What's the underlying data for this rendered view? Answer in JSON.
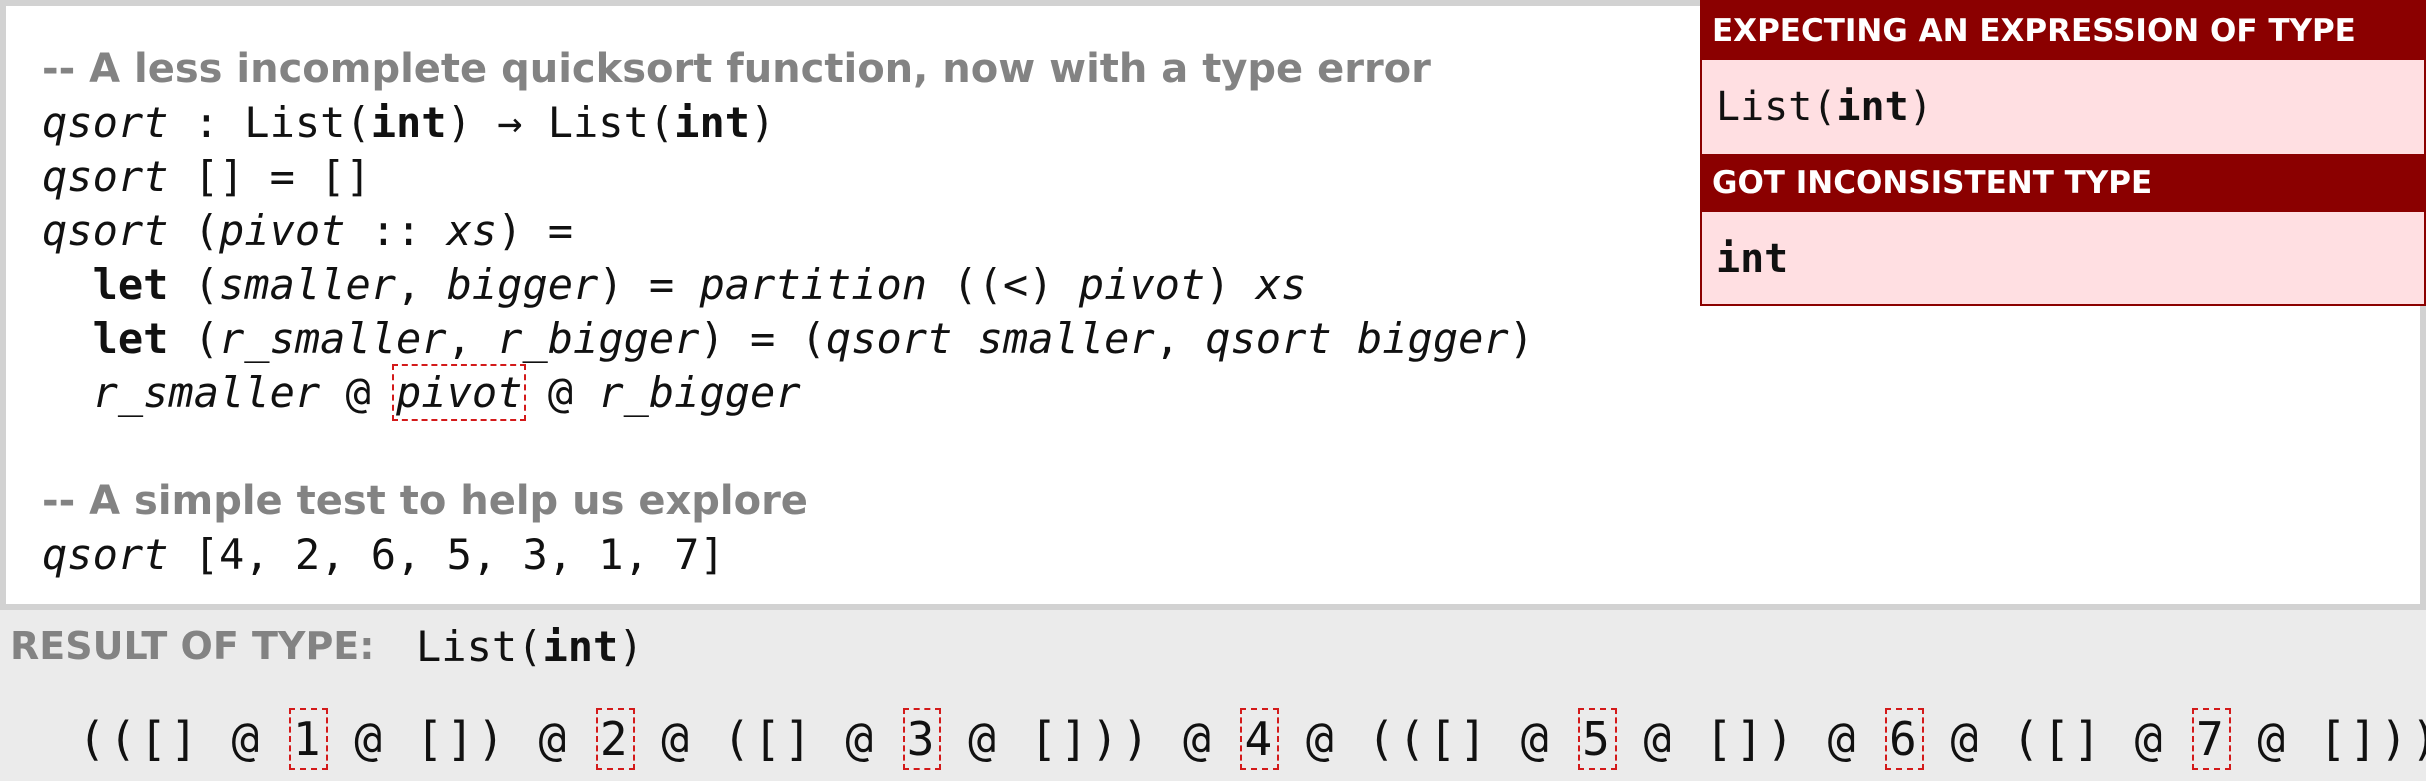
{
  "editor": {
    "comment1": "-- A less incomplete quicksort function, now with a type error",
    "sig": {
      "fn": "qsort",
      "sep": " : List(",
      "t1": "int",
      "arrow": ") → List(",
      "t2": "int",
      "close": ")"
    },
    "line_empty": {
      "fn": "qsort",
      "rest": " [] = []"
    },
    "line_cons": {
      "fn": "qsort",
      "open": " (",
      "pivot": "pivot",
      "cons": " :: ",
      "xs": "xs",
      "rest": ") ="
    },
    "line_let1": {
      "kw": "let",
      "p1": " (",
      "smaller": "smaller",
      "comma": ", ",
      "bigger": "bigger",
      "p2": ") = ",
      "partition": "partition",
      "p3": " ((<) ",
      "pivot": "pivot",
      "p4": ") ",
      "xs": "xs"
    },
    "line_let2": {
      "kw": "let",
      "p1": " (",
      "r_smaller": "r_smaller",
      "comma": ", ",
      "r_bigger": "r_bigger",
      "p2": ") = (",
      "qsort1": "qsort",
      "sp1": " ",
      "smaller": "smaller",
      "comma2": ", ",
      "qsort2": "qsort",
      "sp2": " ",
      "bigger": "bigger",
      "p3": ")"
    },
    "line_body": {
      "r_smaller": "r_smaller",
      "at1": " @ ",
      "pivot": "pivot",
      "at2": " @ ",
      "r_bigger": "r_bigger"
    },
    "comment2": "-- A simple test to help us explore",
    "test": {
      "fn": "qsort",
      "rest": " [4, 2, 6, 5, 3, 1, 7]"
    }
  },
  "popup": {
    "expecting_header": "EXPECTING AN EXPRESSION OF TYPE",
    "expecting_pre": "List(",
    "expecting_type": "int",
    "expecting_post": ")",
    "got_header": "GOT INCONSISTENT TYPE",
    "got_type": "int"
  },
  "result": {
    "label": "RESULT OF TYPE:",
    "type_pre": "List(",
    "type_inner": "int",
    "type_post": ")",
    "expr": {
      "s0": "(([] @ ",
      "h1": "1",
      "s1": " @ []) @ ",
      "h2": "2",
      "s2": " @ ([] @ ",
      "h3": "3",
      "s3": " @ [])) @ ",
      "h4": "4",
      "s4": " @ (([] @ ",
      "h5": "5",
      "s5": " @ []) @ ",
      "h6": "6",
      "s6": " @ ([] @ ",
      "h7": "7",
      "s7": " @ []))"
    }
  },
  "colors": {
    "error_header": "#8b0000",
    "error_bg": "#ffdfe2",
    "hole_outline": "#d31a1a",
    "comment": "#838383",
    "result_bg": "#ebebeb"
  }
}
